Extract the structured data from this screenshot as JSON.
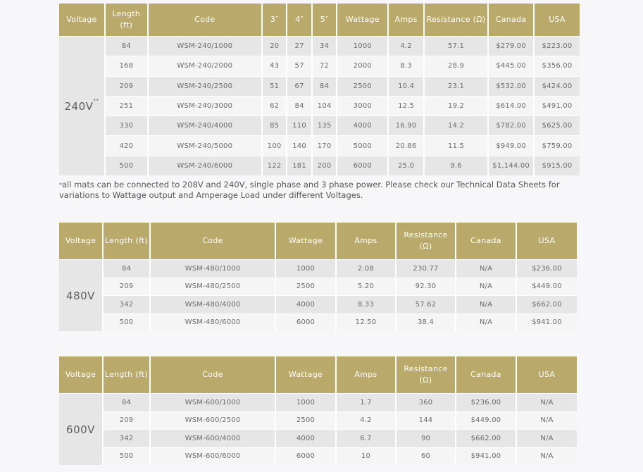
{
  "t240": {
    "headers": [
      "Voltage",
      "Length (ft)",
      "Code",
      "3″",
      "4″",
      "5″",
      "Wattage",
      "Amps",
      "Resistance (Ω)",
      "Canada",
      "USA"
    ],
    "voltage": "240V",
    "voltage_mark": "**",
    "rows": [
      [
        "84",
        "WSM-240/1000",
        "20",
        "27",
        "34",
        "1000",
        "4.2",
        "57.1",
        "$279.00",
        "$223.00"
      ],
      [
        "168",
        "WSM-240/2000",
        "43",
        "57",
        "72",
        "2000",
        "8.3",
        "28.9",
        "$445.00",
        "$356.00"
      ],
      [
        "209",
        "WSM-240/2500",
        "51",
        "67",
        "84",
        "2500",
        "10.4",
        "23.1",
        "$532.00",
        "$424.00"
      ],
      [
        "251",
        "WSM-240/3000",
        "62",
        "84",
        "104",
        "3000",
        "12.5",
        "19.2",
        "$614.00",
        "$491.00"
      ],
      [
        "330",
        "WSM-240/4000",
        "85",
        "110",
        "135",
        "4000",
        "16.90",
        "14.2",
        "$782.00",
        "$625.00"
      ],
      [
        "420",
        "WSM-240/5000",
        "100",
        "140",
        "170",
        "5000",
        "20.86",
        "11.5",
        "$949.00",
        "$759.00"
      ],
      [
        "500",
        "WSM-240/6000",
        "122",
        "181",
        "200",
        "6000",
        "25.0",
        "9.6",
        "$1,144.00",
        "$915.00"
      ]
    ]
  },
  "note": {
    "marker": "*",
    "text": "all mats can be connected to 208V and 240V, single phase and 3 phase power. Please check our Technical Data Sheets for variations to Wattage output and Amperage Load under different Voltages."
  },
  "t480": {
    "headers": [
      "Voltage",
      "Length (ft)",
      "Code",
      "Wattage",
      "Amps",
      "Resistance (Ω)",
      "Canada",
      "USA"
    ],
    "voltage": "480V",
    "rows": [
      [
        "84",
        "WSM-480/1000",
        "1000",
        "2.08",
        "230.77",
        "N/A",
        "$236.00"
      ],
      [
        "209",
        "WSM-480/2500",
        "2500",
        "5.20",
        "92.30",
        "N/A",
        "$449.00"
      ],
      [
        "342",
        "WSM-480/4000",
        "4000",
        "8.33",
        "57.62",
        "N/A",
        "$662.00"
      ],
      [
        "500",
        "WSM-480/6000",
        "6000",
        "12.50",
        "38.4",
        "N/A",
        "$941.00"
      ]
    ]
  },
  "t600": {
    "headers": [
      "Voltage",
      "Length (ft)",
      "Code",
      "Wattage",
      "Amps",
      "Resistance (Ω)",
      "Canada",
      "USA"
    ],
    "voltage": "600V",
    "rows": [
      [
        "84",
        "WSM-600/1000",
        "1000",
        "1.7",
        "360",
        "$236.00",
        "N/A"
      ],
      [
        "209",
        "WSM-600/2500",
        "2500",
        "4.2",
        "144",
        "$449.00",
        "N/A"
      ],
      [
        "342",
        "WSM-600/4000",
        "4000",
        "6.7",
        "90",
        "$662.00",
        "N/A"
      ],
      [
        "500",
        "WSM-600/6000",
        "6000",
        "10",
        "60",
        "$941.00",
        "N/A"
      ]
    ]
  },
  "colors": {
    "header_bg": "#b9aa6c",
    "row_dark": "#e6e6e6",
    "row_light": "#f5f5f5"
  }
}
